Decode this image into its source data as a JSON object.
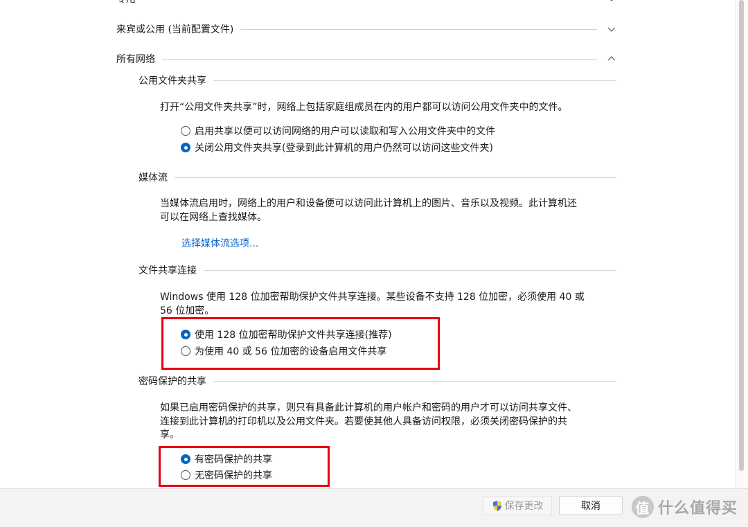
{
  "sections": {
    "private_partial": "专用",
    "guest_public": "来宾或公用 (当前配置文件)",
    "all_networks": "所有网络"
  },
  "public_folder": {
    "title": "公用文件夹共享",
    "description": "打开“公用文件夹共享”时，网络上包括家庭组成员在内的用户都可以访问公用文件夹中的文件。",
    "option_on": "启用共享以便可以访问网络的用户可以读取和写入公用文件夹中的文件",
    "option_off": "关闭公用文件夹共享(登录到此计算机的用户仍然可以访问这些文件夹)",
    "selected": "off"
  },
  "media": {
    "title": "媒体流",
    "description_line1": "当媒体流启用时，网络上的用户和设备便可以访问此计算机上的图片、音乐以及视频。此计算机还",
    "description_line2": "可以在网络上查找媒体。",
    "link": "选择媒体流选项..."
  },
  "file_sharing": {
    "title": "文件共享连接",
    "description_line1": "Windows 使用 128 位加密帮助保护文件共享连接。某些设备不支持 128 位加密，必须使用 40 或",
    "description_line2": "56 位加密。",
    "option_128": "使用 128 位加密帮助保护文件共享连接(推荐)",
    "option_40_56": "为使用 40 或 56 位加密的设备启用文件共享",
    "selected": "128"
  },
  "password": {
    "title": "密码保护的共享",
    "description_line1": "如果已启用密码保护的共享，则只有具备此计算机的用户帐户和密码的用户才可以访问共享文件、",
    "description_line2": "连接到此计算机的打印机以及公用文件夹。若要使其他人具备访问权限，必须关闭密码保护的共",
    "description_line3": "享。",
    "option_on": "有密码保护的共享",
    "option_off": "无密码保护的共享",
    "selected": "on"
  },
  "footer": {
    "save_label": "保存更改",
    "cancel_label": "取消"
  },
  "watermark": {
    "logo_glyph": "值",
    "text": "什么值得买"
  },
  "colors": {
    "accent": "#0067c0",
    "link": "#0a64c8",
    "highlight": "#e60012"
  }
}
